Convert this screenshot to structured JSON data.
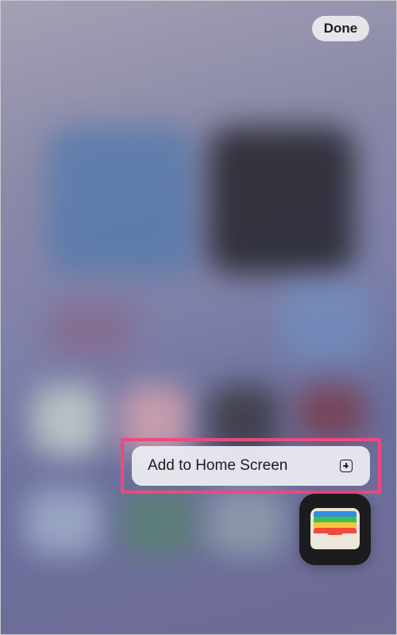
{
  "header": {
    "done_label": "Done"
  },
  "context_menu": {
    "items": [
      {
        "label": "Add to Home Screen",
        "icon": "plus-square-icon"
      }
    ]
  },
  "widget": {
    "icon": "wallet-icon",
    "card_colors": [
      "#2f8de4",
      "#3cc14a",
      "#f6c544",
      "#ef4a3c"
    ]
  },
  "colors": {
    "highlight": "#f0487d",
    "menu_bg": "#ececf2",
    "done_bg": "#e5e5ea"
  }
}
